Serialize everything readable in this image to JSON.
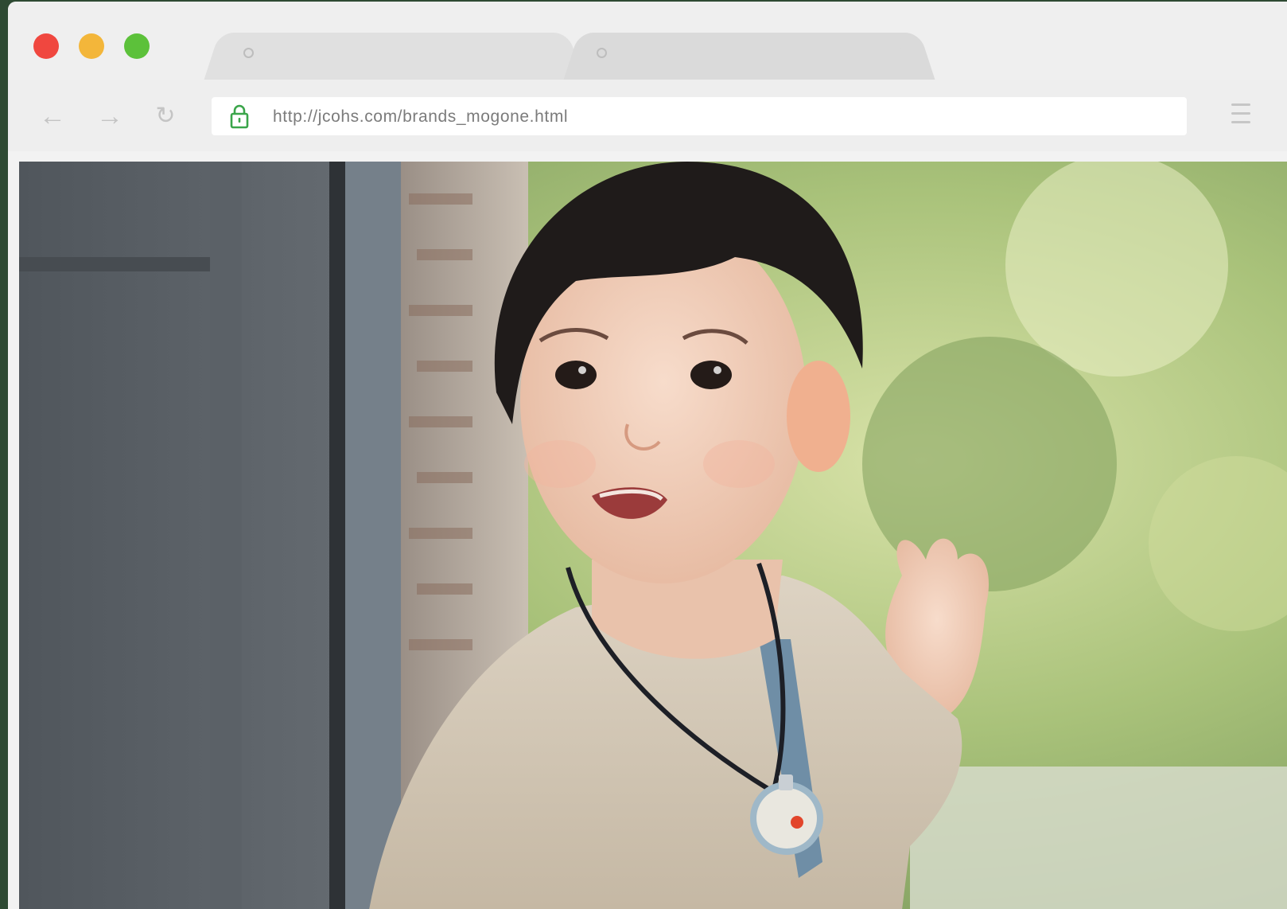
{
  "window": {
    "controls": [
      "close",
      "minimize",
      "zoom"
    ],
    "colors": {
      "close": "#f0473f",
      "minimize": "#f3b63a",
      "zoom": "#5cc13a"
    }
  },
  "tabs": [
    {
      "icon": "tab-favicon-icon",
      "label": ""
    },
    {
      "icon": "tab-favicon-icon",
      "label": ""
    }
  ],
  "toolbar": {
    "back_icon": "←",
    "forward_icon": "→",
    "reload_icon": "↻",
    "lock_color": "#3aa54a",
    "url": "http://jcohs.com/brands_mogone.html"
  },
  "content": {
    "image_subject": "toddler-with-pendant-photo"
  }
}
